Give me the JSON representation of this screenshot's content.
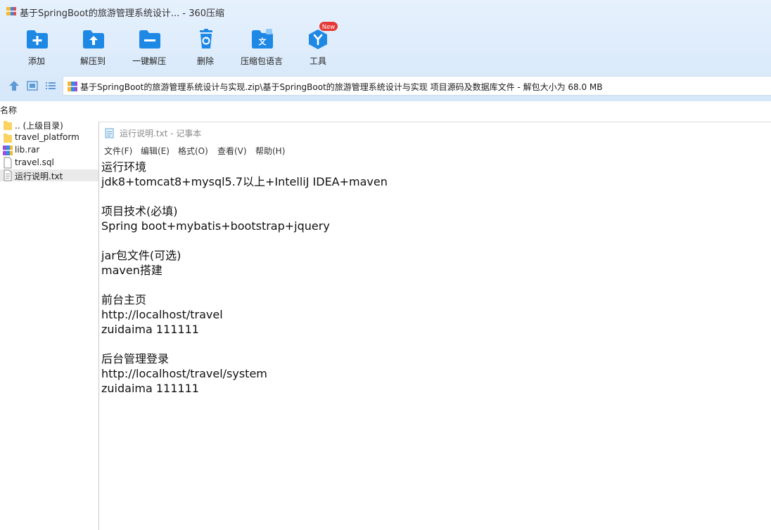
{
  "window": {
    "title": "基于SpringBoot的旅游管理系统设计... - 360压缩"
  },
  "toolbar": {
    "buttons": [
      {
        "label": "添加",
        "icon": "add-icon"
      },
      {
        "label": "解压到",
        "icon": "extract-to-icon"
      },
      {
        "label": "一键解压",
        "icon": "one-click-extract-icon"
      },
      {
        "label": "删除",
        "icon": "delete-icon"
      },
      {
        "label": "压缩包语言",
        "icon": "language-icon"
      },
      {
        "label": "工具",
        "icon": "tools-icon",
        "badge": "New"
      }
    ]
  },
  "address": {
    "path": "基于SpringBoot的旅游管理系统设计与实现.zip\\基于SpringBoot的旅游管理系统设计与实现 项目源码及数据库文件 - 解包大小为 68.0 MB"
  },
  "file_list": {
    "header": "名称",
    "items": [
      {
        "name": ".. (上级目录)",
        "icon": "folder-icon"
      },
      {
        "name": "travel_platform",
        "icon": "folder-icon"
      },
      {
        "name": "lib.rar",
        "icon": "rar-archive-icon"
      },
      {
        "name": "travel.sql",
        "icon": "file-icon"
      },
      {
        "name": "运行说明.txt",
        "icon": "text-file-icon",
        "selected": true
      }
    ]
  },
  "notepad": {
    "title": "运行说明.txt - 记事本",
    "menu": [
      "文件(F)",
      "编辑(E)",
      "格式(O)",
      "查看(V)",
      "帮助(H)"
    ],
    "lines": [
      "运行环境",
      "jdk8+tomcat8+mysql5.7以上+IntelliJ IDEA+maven",
      "",
      "项目技术(必填)",
      "Spring boot+mybatis+bootstrap+jquery",
      "",
      "jar包文件(可选)",
      "maven搭建",
      "",
      "前台主页",
      "http://localhost/travel",
      "zuidaima 111111",
      "",
      "后台管理登录",
      "http://localhost/travel/system",
      "zuidaima 111111"
    ]
  },
  "colors": {
    "accent": "#1e88e5",
    "badge": "#e53935",
    "chrome_bg": "#dcebfb",
    "selection": "#eaeaea"
  }
}
